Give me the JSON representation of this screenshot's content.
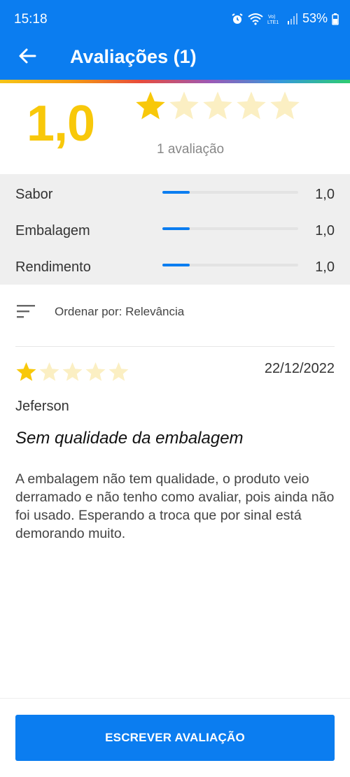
{
  "status_bar": {
    "time": "15:18",
    "battery": "53%"
  },
  "app_bar": {
    "title": "Avaliações (1)"
  },
  "summary": {
    "score": "1,0",
    "rating": 1,
    "max_rating": 5,
    "count_text": "1 avaliação"
  },
  "criteria": [
    {
      "label": "Sabor",
      "value": "1,0",
      "fraction": 0.2
    },
    {
      "label": "Embalagem",
      "value": "1,0",
      "fraction": 0.2
    },
    {
      "label": "Rendimento",
      "value": "1,0",
      "fraction": 0.2
    }
  ],
  "sort": {
    "label": "Ordenar por: Relevância"
  },
  "review": {
    "rating": 1,
    "date": "22/12/2022",
    "author": "Jeferson",
    "title": "Sem qualidade da embalagem",
    "body": "A embalagem não tem qualidade, o produto veio derramado e não tenho como avaliar, pois ainda não foi usado. Esperando a troca que por sinal está demorando muito."
  },
  "cta": {
    "label": "ESCREVER AVALIAÇÃO"
  },
  "colors": {
    "primary": "#0b7df0",
    "star_filled": "#f8c80a",
    "star_empty": "#fbefc3"
  }
}
